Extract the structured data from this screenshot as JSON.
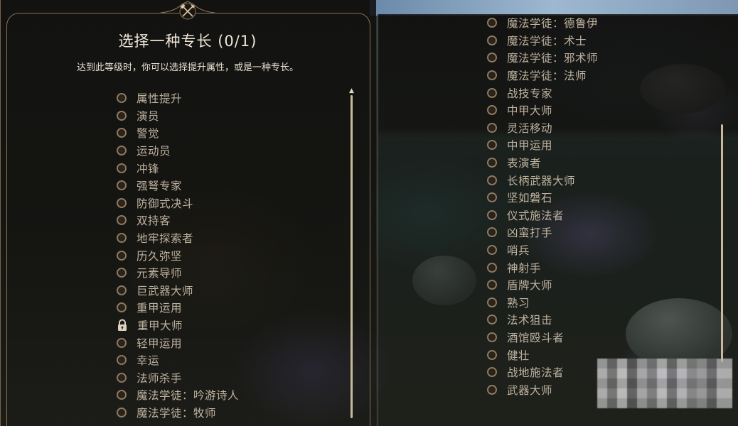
{
  "dialog": {
    "title": "选择一种专长 (0/1)",
    "subtitle": "达到此等级时，你可以选择提升属性，或是一种专长。",
    "crest_icon": "crossed-axe-hammer-icon"
  },
  "left_feats": [
    {
      "label": "属性提升",
      "state": "radio"
    },
    {
      "label": "演员",
      "state": "radio"
    },
    {
      "label": "警觉",
      "state": "radio"
    },
    {
      "label": "运动员",
      "state": "radio"
    },
    {
      "label": "冲锋",
      "state": "radio"
    },
    {
      "label": "强弩专家",
      "state": "radio"
    },
    {
      "label": "防御式决斗",
      "state": "radio"
    },
    {
      "label": "双持客",
      "state": "radio"
    },
    {
      "label": "地牢探索者",
      "state": "radio"
    },
    {
      "label": "历久弥坚",
      "state": "radio"
    },
    {
      "label": "元素导师",
      "state": "radio"
    },
    {
      "label": "巨武器大师",
      "state": "radio"
    },
    {
      "label": "重甲运用",
      "state": "radio"
    },
    {
      "label": "重甲大师",
      "state": "locked"
    },
    {
      "label": "轻甲运用",
      "state": "radio"
    },
    {
      "label": "幸运",
      "state": "radio"
    },
    {
      "label": "法师杀手",
      "state": "radio"
    },
    {
      "label": "魔法学徒：吟游诗人",
      "state": "radio"
    },
    {
      "label": "魔法学徒：牧师",
      "state": "radio"
    }
  ],
  "right_feats": [
    {
      "label": "魔法学徒：德鲁伊",
      "state": "radio"
    },
    {
      "label": "魔法学徒：术士",
      "state": "radio"
    },
    {
      "label": "魔法学徒：邪术师",
      "state": "radio"
    },
    {
      "label": "魔法学徒：法师",
      "state": "radio"
    },
    {
      "label": "战技专家",
      "state": "radio"
    },
    {
      "label": "中甲大师",
      "state": "radio"
    },
    {
      "label": "灵活移动",
      "state": "radio"
    },
    {
      "label": "中甲运用",
      "state": "radio"
    },
    {
      "label": "表演者",
      "state": "radio"
    },
    {
      "label": "长柄武器大师",
      "state": "radio"
    },
    {
      "label": "坚如磐石",
      "state": "radio"
    },
    {
      "label": "仪式施法者",
      "state": "radio"
    },
    {
      "label": "凶蛮打手",
      "state": "radio"
    },
    {
      "label": "哨兵",
      "state": "radio"
    },
    {
      "label": "神射手",
      "state": "radio"
    },
    {
      "label": "盾牌大师",
      "state": "radio"
    },
    {
      "label": "熟习",
      "state": "radio"
    },
    {
      "label": "法术狙击",
      "state": "radio"
    },
    {
      "label": "酒馆殴斗者",
      "state": "radio"
    },
    {
      "label": "健壮",
      "state": "radio"
    },
    {
      "label": "战地施法者",
      "state": "radio"
    },
    {
      "label": "武器大师",
      "state": "radio"
    }
  ],
  "colors": {
    "accent": "#8c7a60",
    "text": "#bfb3a0",
    "title": "#efe6d6",
    "frame": "#8a7150"
  }
}
